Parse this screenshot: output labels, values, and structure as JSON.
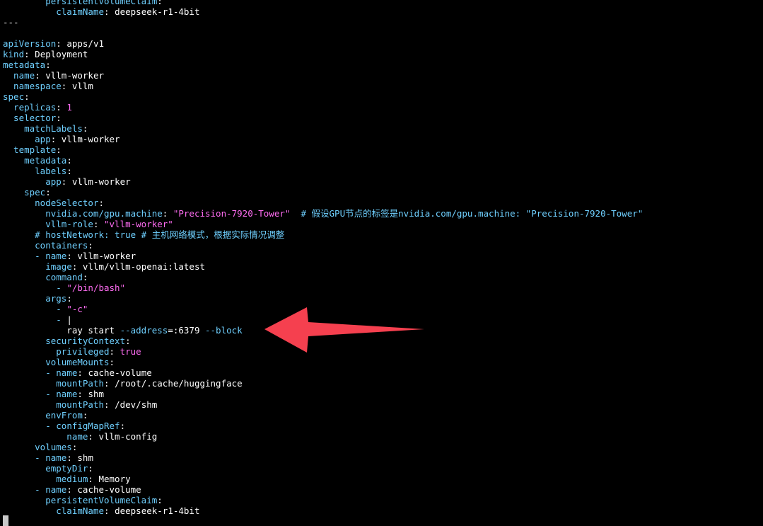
{
  "colors": {
    "background": "#000000",
    "key": "#6fd0ff",
    "text": "#ffffff",
    "string": "#ff6cf2",
    "comment": "#6fd0ff",
    "cursor": "#c8c8c8",
    "arrow": "#f5404f"
  },
  "icons": [
    "text-cursor-icon",
    "red-arrow-annotation-icon"
  ],
  "lines": [
    [
      {
        "t": "        persistentVolumeClaim",
        "c": "key"
      },
      {
        "t": ":",
        "c": "punct"
      }
    ],
    [
      {
        "t": "          claimName",
        "c": "key"
      },
      {
        "t": ": ",
        "c": "punct"
      },
      {
        "t": "deepseek-r1-4bit",
        "c": "val"
      }
    ],
    [
      {
        "t": "---",
        "c": "val"
      }
    ],
    [],
    [
      {
        "t": "apiVersion",
        "c": "key"
      },
      {
        "t": ": ",
        "c": "punct"
      },
      {
        "t": "apps/v1",
        "c": "val"
      }
    ],
    [
      {
        "t": "kind",
        "c": "key"
      },
      {
        "t": ": ",
        "c": "punct"
      },
      {
        "t": "Deployment",
        "c": "val"
      }
    ],
    [
      {
        "t": "metadata",
        "c": "key"
      },
      {
        "t": ":",
        "c": "punct"
      }
    ],
    [
      {
        "t": "  name",
        "c": "key"
      },
      {
        "t": ": ",
        "c": "punct"
      },
      {
        "t": "vllm-worker",
        "c": "val"
      }
    ],
    [
      {
        "t": "  namespace",
        "c": "key"
      },
      {
        "t": ": ",
        "c": "punct"
      },
      {
        "t": "vllm",
        "c": "val"
      }
    ],
    [
      {
        "t": "spec",
        "c": "key"
      },
      {
        "t": ":",
        "c": "punct"
      }
    ],
    [
      {
        "t": "  replicas",
        "c": "key"
      },
      {
        "t": ": ",
        "c": "punct"
      },
      {
        "t": "1",
        "c": "num"
      }
    ],
    [
      {
        "t": "  selector",
        "c": "key"
      },
      {
        "t": ":",
        "c": "punct"
      }
    ],
    [
      {
        "t": "    matchLabels",
        "c": "key"
      },
      {
        "t": ":",
        "c": "punct"
      }
    ],
    [
      {
        "t": "      app",
        "c": "key"
      },
      {
        "t": ": ",
        "c": "punct"
      },
      {
        "t": "vllm-worker",
        "c": "val"
      }
    ],
    [
      {
        "t": "  template",
        "c": "key"
      },
      {
        "t": ":",
        "c": "punct"
      }
    ],
    [
      {
        "t": "    metadata",
        "c": "key"
      },
      {
        "t": ":",
        "c": "punct"
      }
    ],
    [
      {
        "t": "      labels",
        "c": "key"
      },
      {
        "t": ":",
        "c": "punct"
      }
    ],
    [
      {
        "t": "        app",
        "c": "key"
      },
      {
        "t": ": ",
        "c": "punct"
      },
      {
        "t": "vllm-worker",
        "c": "val"
      }
    ],
    [
      {
        "t": "    spec",
        "c": "key"
      },
      {
        "t": ":",
        "c": "punct"
      }
    ],
    [
      {
        "t": "      nodeSelector",
        "c": "key"
      },
      {
        "t": ":",
        "c": "punct"
      }
    ],
    [
      {
        "t": "        nvidia.com/gpu.machine",
        "c": "key"
      },
      {
        "t": ": ",
        "c": "punct"
      },
      {
        "t": "\"Precision-7920-Tower\"",
        "c": "str"
      },
      {
        "t": "  # 假设GPU节点的标签是nvidia.com/gpu.machine: \"Precision-7920-Tower\"",
        "c": "comment"
      }
    ],
    [
      {
        "t": "        vllm-role",
        "c": "key"
      },
      {
        "t": ": ",
        "c": "punct"
      },
      {
        "t": "\"vllm-worker\"",
        "c": "str"
      }
    ],
    [
      {
        "t": "      # hostNetwork: true # 主机网络模式，根据实际情况调整",
        "c": "comment"
      }
    ],
    [
      {
        "t": "      containers",
        "c": "key"
      },
      {
        "t": ":",
        "c": "punct"
      }
    ],
    [
      {
        "t": "      - ",
        "c": "dash"
      },
      {
        "t": "name",
        "c": "key"
      },
      {
        "t": ": ",
        "c": "punct"
      },
      {
        "t": "vllm-worker",
        "c": "val"
      }
    ],
    [
      {
        "t": "        image",
        "c": "key"
      },
      {
        "t": ": ",
        "c": "punct"
      },
      {
        "t": "vllm/vllm-openai:latest",
        "c": "val"
      }
    ],
    [
      {
        "t": "        command",
        "c": "key"
      },
      {
        "t": ":",
        "c": "punct"
      }
    ],
    [
      {
        "t": "          - ",
        "c": "dash"
      },
      {
        "t": "\"/bin/bash\"",
        "c": "str"
      }
    ],
    [
      {
        "t": "        args",
        "c": "key"
      },
      {
        "t": ":",
        "c": "punct"
      }
    ],
    [
      {
        "t": "          - ",
        "c": "dash"
      },
      {
        "t": "\"-c\"",
        "c": "str"
      }
    ],
    [
      {
        "t": "          - ",
        "c": "dash"
      },
      {
        "t": "|",
        "c": "val"
      }
    ],
    [
      {
        "t": "            ray start ",
        "c": "val"
      },
      {
        "t": "--address",
        "c": "flag"
      },
      {
        "t": "=:6379 ",
        "c": "val"
      },
      {
        "t": "--block",
        "c": "flag"
      }
    ],
    [
      {
        "t": "        securityContext",
        "c": "key"
      },
      {
        "t": ":",
        "c": "punct"
      }
    ],
    [
      {
        "t": "          privileged",
        "c": "key"
      },
      {
        "t": ": ",
        "c": "punct"
      },
      {
        "t": "true",
        "c": "bool"
      }
    ],
    [
      {
        "t": "        volumeMounts",
        "c": "key"
      },
      {
        "t": ":",
        "c": "punct"
      }
    ],
    [
      {
        "t": "        - ",
        "c": "dash"
      },
      {
        "t": "name",
        "c": "key"
      },
      {
        "t": ": ",
        "c": "punct"
      },
      {
        "t": "cache-volume",
        "c": "val"
      }
    ],
    [
      {
        "t": "          mountPath",
        "c": "key"
      },
      {
        "t": ": ",
        "c": "punct"
      },
      {
        "t": "/root/.cache/huggingface",
        "c": "val"
      }
    ],
    [
      {
        "t": "        - ",
        "c": "dash"
      },
      {
        "t": "name",
        "c": "key"
      },
      {
        "t": ": ",
        "c": "punct"
      },
      {
        "t": "shm",
        "c": "val"
      }
    ],
    [
      {
        "t": "          mountPath",
        "c": "key"
      },
      {
        "t": ": ",
        "c": "punct"
      },
      {
        "t": "/dev/shm",
        "c": "val"
      }
    ],
    [
      {
        "t": "        envFrom",
        "c": "key"
      },
      {
        "t": ":",
        "c": "punct"
      }
    ],
    [
      {
        "t": "        - ",
        "c": "dash"
      },
      {
        "t": "configMapRef",
        "c": "key"
      },
      {
        "t": ":",
        "c": "punct"
      }
    ],
    [
      {
        "t": "            name",
        "c": "key"
      },
      {
        "t": ": ",
        "c": "punct"
      },
      {
        "t": "vllm-config",
        "c": "val"
      }
    ],
    [
      {
        "t": "      volumes",
        "c": "key"
      },
      {
        "t": ":",
        "c": "punct"
      }
    ],
    [
      {
        "t": "      - ",
        "c": "dash"
      },
      {
        "t": "name",
        "c": "key"
      },
      {
        "t": ": ",
        "c": "punct"
      },
      {
        "t": "shm",
        "c": "val"
      }
    ],
    [
      {
        "t": "        emptyDir",
        "c": "key"
      },
      {
        "t": ":",
        "c": "punct"
      }
    ],
    [
      {
        "t": "          medium",
        "c": "key"
      },
      {
        "t": ": ",
        "c": "punct"
      },
      {
        "t": "Memory",
        "c": "val"
      }
    ],
    [
      {
        "t": "      - ",
        "c": "dash"
      },
      {
        "t": "name",
        "c": "key"
      },
      {
        "t": ": ",
        "c": "punct"
      },
      {
        "t": "cache-volume",
        "c": "val"
      }
    ],
    [
      {
        "t": "        persistentVolumeClaim",
        "c": "key"
      },
      {
        "t": ":",
        "c": "punct"
      }
    ],
    [
      {
        "t": "          claimName",
        "c": "key"
      },
      {
        "t": ": ",
        "c": "punct"
      },
      {
        "t": "deepseek-r1-4bit",
        "c": "val"
      }
    ]
  ]
}
